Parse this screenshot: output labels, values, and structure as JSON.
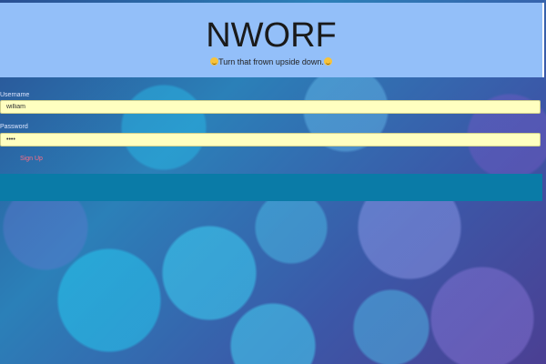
{
  "header": {
    "brand": "NWORF",
    "tagline": "Turn that frown upside down."
  },
  "form": {
    "username_label": "Username",
    "username_value": "william",
    "password_label": "Password",
    "password_value": "••••",
    "signup_label": "Sign Up"
  },
  "colors": {
    "header_bg": "#93bff9",
    "field_bg": "#ffffc0",
    "signup_text": "#ff6d86",
    "strip_bg": "#0a7ba7"
  },
  "icons": {
    "tagline_left": "smiley-emoji-icon",
    "tagline_right": "smiley-emoji-icon"
  }
}
